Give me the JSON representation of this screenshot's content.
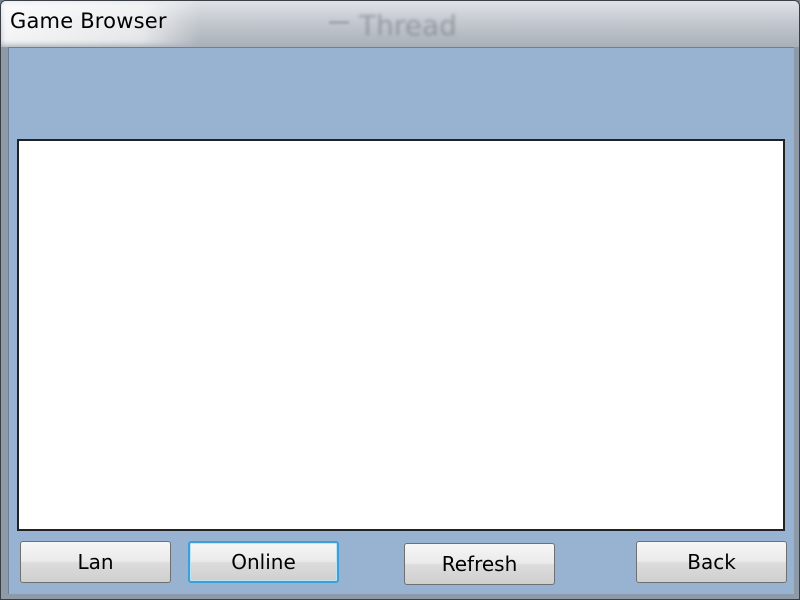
{
  "window": {
    "title": "Game Browser",
    "background_window_text": "Thread"
  },
  "buttons": {
    "lan": "Lan",
    "online": "Online",
    "refresh": "Refresh",
    "back": "Back"
  },
  "colors": {
    "client_background": "#98b3d1",
    "list_background": "#ffffff",
    "focus_border": "#3c9fd6"
  }
}
